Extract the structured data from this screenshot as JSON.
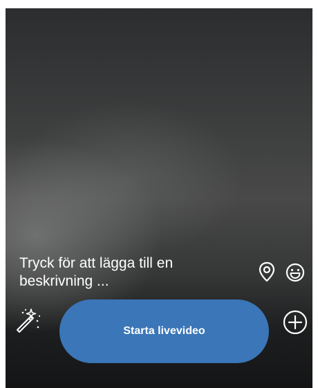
{
  "caption": {
    "placeholder": "Tryck för att lägga till en beskrivning ..."
  },
  "actions": {
    "location_icon": "location-pin-icon",
    "emoji_icon": "smiley-face-icon",
    "effects_icon": "magic-wand-icon",
    "add_icon": "plus-circle-icon"
  },
  "live_button": {
    "label": "Starta livevideo",
    "color": "#3a76b8"
  }
}
